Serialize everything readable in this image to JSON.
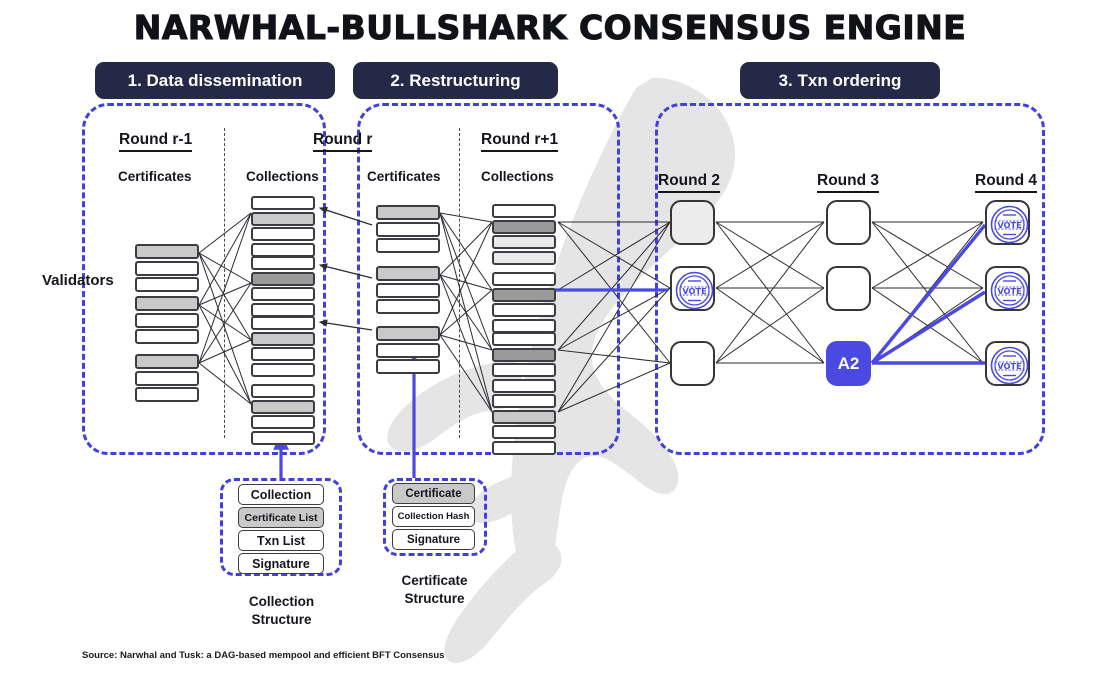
{
  "title": "NARWHAL-BULLSHARK CONSENSUS ENGINE",
  "colors": {
    "badge_bg": "#232947",
    "panel_dash": "#4040e0",
    "accent_blue": "#4a4ae2",
    "node_border": "#35353b",
    "gray_row": "#c9c9c9",
    "dark_gray_row": "#9a9a9a",
    "text": "#15161c",
    "watermark": "#e4e4e4"
  },
  "badges": [
    {
      "id": "badge-1",
      "label": "1. Data dissemination"
    },
    {
      "id": "badge-2",
      "label": "2. Restructuring"
    },
    {
      "id": "badge-3",
      "label": "3. Txn ordering"
    }
  ],
  "panel1": {
    "validators_label": "Validators",
    "rounds": [
      {
        "round": "Round r-1",
        "column": "Certificates"
      },
      {
        "round": "Round r",
        "column": "Collections"
      }
    ]
  },
  "panel2": {
    "rounds": [
      {
        "round": "Round r",
        "column": "Certificates"
      },
      {
        "round": "Round r+1",
        "column": "Collections"
      }
    ]
  },
  "panel3": {
    "rounds": [
      "Round 2",
      "Round 3",
      "Round 4"
    ],
    "nodes": {
      "round2": [
        {
          "type": "plain",
          "shaded": true,
          "label": ""
        },
        {
          "type": "vote",
          "shaded": false,
          "label": "VOTE"
        },
        {
          "type": "plain",
          "shaded": false,
          "label": ""
        }
      ],
      "round3": [
        {
          "type": "plain",
          "shaded": false,
          "label": ""
        },
        {
          "type": "plain",
          "shaded": false,
          "label": ""
        },
        {
          "type": "anchor",
          "shaded": false,
          "label": "A2"
        }
      ],
      "round4": [
        {
          "type": "vote",
          "shaded": false,
          "label": "VOTE"
        },
        {
          "type": "vote",
          "shaded": false,
          "label": "VOTE"
        },
        {
          "type": "vote",
          "shaded": false,
          "label": "VOTE"
        }
      ]
    }
  },
  "collection_structure": {
    "caption_line1": "Collection",
    "caption_line2": "Structure",
    "rows": [
      {
        "label": "Collection",
        "gray": false,
        "small": false
      },
      {
        "label": "Certificate List",
        "gray": true,
        "small": true
      },
      {
        "label": "Txn List",
        "gray": false,
        "small": false
      },
      {
        "label": "Signature",
        "gray": false,
        "small": false
      }
    ]
  },
  "certificate_structure": {
    "caption_line1": "Certificate",
    "caption_line2": "Structure",
    "rows": [
      {
        "label": "Certificate",
        "gray": true,
        "small": false
      },
      {
        "label": "Collection Hash",
        "gray": false,
        "small": true
      },
      {
        "label": "Signature",
        "gray": false,
        "small": false
      }
    ]
  },
  "source": "Source: Narwhal and Tusk: a DAG-based mempool and efficient BFT Consensus"
}
